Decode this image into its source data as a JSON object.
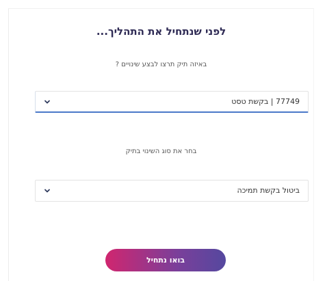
{
  "title": "לפני שנתחיל את התהליך...",
  "question_file": {
    "label": "באיזה תיק תרצו לבצע שינויים ?",
    "selected_value": "77749 | בקשת טסט"
  },
  "question_change_type": {
    "label": "בחר את סוג השינוי בתיק",
    "selected_value": "ביטול בקשת תמיכה"
  },
  "start_button": {
    "label": "בואו נתחיל"
  },
  "colors": {
    "title": "#2f2b55",
    "focus_border": "#4a78c8",
    "button_gradient_start": "#d0266f",
    "button_gradient_end": "#55489f"
  },
  "icons": {
    "select_chevron": "chevron-down-icon"
  }
}
